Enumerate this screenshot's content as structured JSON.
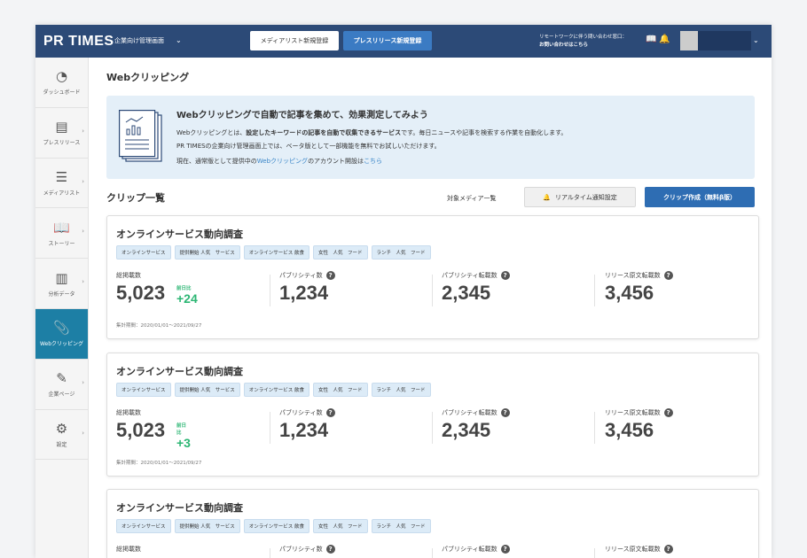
{
  "header": {
    "logo": "PR TIMES",
    "subtitle": "企業向け管理画面",
    "media_btn": "メディアリスト新規登録",
    "press_btn": "プレスリリース新規登録",
    "contact_line1": "リモートワークに伴う問い合わせ窓口：",
    "contact_line2": "お問い合わせはこちら"
  },
  "sidebar": {
    "items": [
      {
        "label": "ダッシュボード",
        "icon": "◔"
      },
      {
        "label": "プレスリリース",
        "icon": "▤"
      },
      {
        "label": "メディアリスト",
        "icon": "☰"
      },
      {
        "label": "ストーリー",
        "icon": "📖"
      },
      {
        "label": "分析データ",
        "icon": "▥"
      },
      {
        "label": "Webクリッピング",
        "icon": "📎"
      },
      {
        "label": "企業ページ",
        "icon": "✎"
      },
      {
        "label": "設定",
        "icon": "⚙"
      }
    ]
  },
  "page": {
    "title": "Webクリッピング"
  },
  "banner": {
    "title": "Webクリッピングで自動で記事を集めて、効果測定してみよう",
    "p1a": "Webクリッピングとは、",
    "p1b": "設定したキーワードの記事を自動で収集できるサービス",
    "p1c": "です。毎日ニュースや記事を検索する作業を自動化します。",
    "p2": "PR TIMESの企業向け管理画面上では、ベータ版として一部機能を無料でお試しいただけます。",
    "p3a": "現在、通常版として提供中の",
    "p3link": "Webクリッピング",
    "p3b": "のアカウント開設は",
    "p3link2": "こちら"
  },
  "clips": {
    "heading": "クリップ一覧",
    "media_list": "対象メディア一覧",
    "realtime_btn": "リアルタイム通知設定",
    "create_btn": "クリップ作成（無料β版）"
  },
  "labels": {
    "total": "総掲載数",
    "delta": "前日比",
    "publicity": "パブリシティ数",
    "publicity_rep": "パブリシティ転載数",
    "release_rep": "リリース原文転載数"
  },
  "cards": [
    {
      "title": "オンラインサービス動向調査",
      "tags": [
        "オンラインサービス",
        "提供開始 人気　サービス",
        "オンラインサービス 飲食",
        "女性　人気　フード",
        "ランチ　人気　フード"
      ],
      "total": "5,023",
      "delta": "+24",
      "publicity": "1,234",
      "publicity_rep": "2,345",
      "release_rep": "3,456",
      "period": "集計期間：2020/01/01～2021/09/27"
    },
    {
      "title": "オンラインサービス動向調査",
      "tags": [
        "オンラインサービス",
        "提供開始 人気　サービス",
        "オンラインサービス 飲食",
        "女性　人気　フード",
        "ランチ　人気　フード"
      ],
      "total": "5,023",
      "delta": "+3",
      "publicity": "1,234",
      "publicity_rep": "2,345",
      "release_rep": "3,456",
      "period": "集計期間：2020/01/01～2021/09/27"
    },
    {
      "title": "オンラインサービス動向調査",
      "tags": [
        "オンラインサービス",
        "提供開始 人気　サービス",
        "オンラインサービス 飲食",
        "女性　人気　フード",
        "ランチ　人気　フード"
      ]
    }
  ]
}
